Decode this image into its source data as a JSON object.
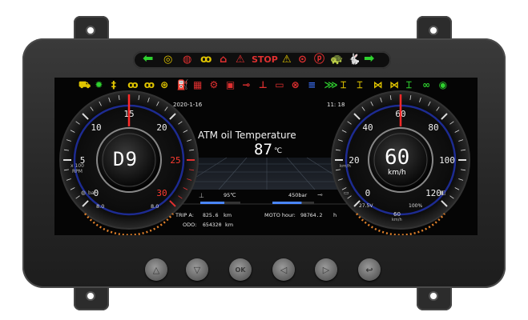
{
  "top_indicators": [
    {
      "icon": "turn-left-arrow-icon",
      "glyph": "⬅",
      "color": "#2fd12f"
    },
    {
      "icon": "parking-brake-icon",
      "glyph": "◎",
      "color": "#e0c400"
    },
    {
      "icon": "pressure-icon",
      "glyph": "◍",
      "color": "#e03030"
    },
    {
      "icon": "glow-plug-icon",
      "glyph": "ꝏ",
      "color": "#e0c400"
    },
    {
      "icon": "engine-check-icon",
      "glyph": "⌂",
      "color": "#e03030"
    },
    {
      "icon": "warning-triangle-icon",
      "glyph": "⚠",
      "color": "#e03030"
    },
    {
      "icon": "stop-text",
      "glyph": "STOP",
      "color": "#e03030"
    },
    {
      "icon": "caution-icon",
      "glyph": "⚠",
      "color": "#e0c400"
    },
    {
      "icon": "brake-circle-icon",
      "glyph": "⊙",
      "color": "#e03030"
    },
    {
      "icon": "parking-circle-icon",
      "glyph": "ⓟ",
      "color": "#e03030"
    },
    {
      "icon": "slow-turtle-icon",
      "glyph": "🐢",
      "color": "#2fd12f"
    },
    {
      "icon": "rabbit-icon",
      "glyph": "🐇",
      "color": "#2fd12f"
    },
    {
      "icon": "turn-right-arrow-icon",
      "glyph": "➡",
      "color": "#2fd12f"
    }
  ],
  "warning_bar": [
    {
      "icon": "truck-icon",
      "glyph": "⛟",
      "color": "#e0c400"
    },
    {
      "icon": "light-icon",
      "glyph": "✹",
      "color": "#2fd12f"
    },
    {
      "icon": "fog-light-icon",
      "glyph": "‡",
      "color": "#e0c400"
    },
    {
      "icon": "glow-plug-icon",
      "glyph": "ꝏ",
      "color": "#e0c400"
    },
    {
      "icon": "glow-plug-2-icon",
      "glyph": "ꝏ",
      "color": "#e0c400"
    },
    {
      "icon": "brake-wear-icon",
      "glyph": "⊛",
      "color": "#e0c400"
    },
    {
      "icon": "fuel-icon",
      "glyph": "⛽",
      "color": "#e0c400"
    },
    {
      "icon": "transmission-icon",
      "glyph": "▦",
      "color": "#e03030"
    },
    {
      "icon": "gear-warning-icon",
      "glyph": "⚙",
      "color": "#e03030"
    },
    {
      "icon": "filter-icon",
      "glyph": "▣",
      "color": "#e03030"
    },
    {
      "icon": "oil-pressure-icon",
      "glyph": "⊸",
      "color": "#e03030"
    },
    {
      "icon": "coolant-temp-icon",
      "glyph": "⊥",
      "color": "#e03030"
    },
    {
      "icon": "battery-icon",
      "glyph": "▭",
      "color": "#e03030"
    },
    {
      "icon": "steering-icon",
      "glyph": "⊗",
      "color": "#e03030"
    },
    {
      "icon": "headlight-icon",
      "glyph": "≡",
      "color": "#3a6df0"
    },
    {
      "icon": "side-light-icon",
      "glyph": "⋙",
      "color": "#2fd12f"
    },
    {
      "icon": "axle-lock-icon",
      "glyph": "⌶",
      "color": "#e0c400"
    },
    {
      "icon": "diff-lock-icon",
      "glyph": "⌶",
      "color": "#e0c400"
    },
    {
      "icon": "diff-lock-2-icon",
      "glyph": "⋈",
      "color": "#e0c400"
    },
    {
      "icon": "diff-lock-3-icon",
      "glyph": "⋈",
      "color": "#e0c400"
    },
    {
      "icon": "axle-icon",
      "glyph": "⌶",
      "color": "#2fd12f"
    },
    {
      "icon": "cruise-icon",
      "glyph": "∞",
      "color": "#2fd12f"
    },
    {
      "icon": "traction-icon",
      "glyph": "◉",
      "color": "#2fd12f"
    }
  ],
  "center": {
    "date": "2020-1-16",
    "time": "11: 18",
    "message_title": "ATM oil Temperature",
    "message_value": "87",
    "message_unit": "℃",
    "coolant_value": "95℃",
    "coolant_level": 0.6,
    "oil_pressure_value": "450bar",
    "oil_level": 0.7,
    "trip_label": "TRIP A:",
    "trip_value": "825.6",
    "trip_unit": "km",
    "odo_label": "ODO:",
    "odo_value": "654320",
    "odo_unit": "km",
    "moto_label": "MOTO hour:",
    "moto_value": "98764.2",
    "moto_unit": "h"
  },
  "tach": {
    "gear": "D9",
    "scale_labels": [
      "0",
      "5",
      "10",
      "15",
      "20",
      "25",
      "30"
    ],
    "red_from": "25",
    "unit_line1": "x 100",
    "unit_line2": "RPM",
    "bar_label": "bar",
    "left_value": "8.0",
    "right_value": "8.0",
    "needle_value": 15,
    "max": 30
  },
  "speedo": {
    "speed": "60",
    "unit": "km/h",
    "scale_labels": [
      "0",
      "20",
      "40",
      "60",
      "80",
      "100",
      "120"
    ],
    "small_unit": "km/h",
    "voltage": "27.5V",
    "percent": "100%",
    "bottom_value": "60",
    "bottom_unit": "km/h",
    "needle_value": 60,
    "max": 120
  },
  "buttons": [
    {
      "name": "up-button",
      "glyph": "△"
    },
    {
      "name": "down-button",
      "glyph": "▽"
    },
    {
      "name": "ok-button",
      "glyph": "OK"
    },
    {
      "name": "left-button",
      "glyph": "◁"
    },
    {
      "name": "right-button",
      "glyph": "▷"
    },
    {
      "name": "back-button",
      "glyph": "↩"
    }
  ]
}
